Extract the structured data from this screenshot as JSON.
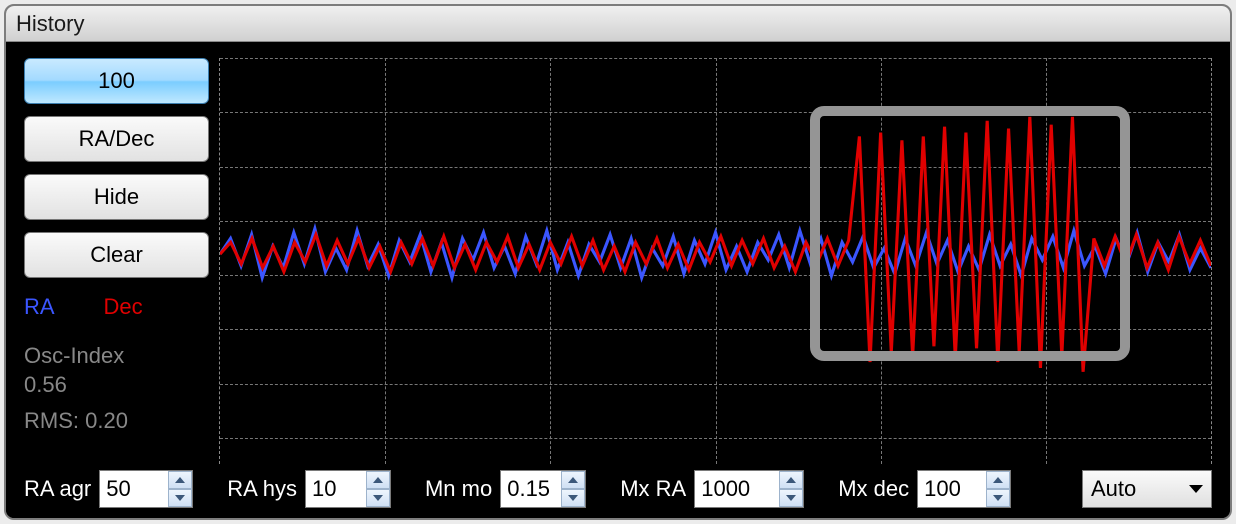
{
  "window": {
    "title": "History"
  },
  "buttons": {
    "scale": "100",
    "mode": "RA/Dec",
    "hide": "Hide",
    "clear": "Clear"
  },
  "legend": {
    "ra": "RA",
    "dec": "Dec"
  },
  "status": {
    "osc_label": "Osc-Index",
    "osc_value": "0.56",
    "rms_label": "RMS:",
    "rms_value": "0.20"
  },
  "params": {
    "ra_agr": {
      "label": "RA agr",
      "value": "50"
    },
    "ra_hys": {
      "label": "RA hys",
      "value": "10"
    },
    "mn_mo": {
      "label": "Mn mo",
      "value": "0.15"
    },
    "mx_ra": {
      "label": "Mx RA",
      "value": "1000"
    },
    "mx_dec": {
      "label": "Mx dec",
      "value": "100"
    }
  },
  "dropdown": {
    "selected": "Auto"
  },
  "colors": {
    "ra": "#3b56ff",
    "dec": "#e00000"
  },
  "chart_data": {
    "type": "line",
    "title": "",
    "xlabel": "",
    "ylabel": "",
    "ylim": [
      -100,
      100
    ],
    "x_range": [
      0,
      960
    ],
    "series": [
      {
        "name": "RA",
        "color": "#3b56ff",
        "values": [
          0,
          8,
          -6,
          10,
          -12,
          4,
          -7,
          11,
          -5,
          13,
          -9,
          3,
          -8,
          12,
          -6,
          5,
          -11,
          7,
          -4,
          10,
          -9,
          6,
          -12,
          8,
          -3,
          11,
          -7,
          4,
          -10,
          9,
          -5,
          12,
          -8,
          6,
          -11,
          5,
          -4,
          10,
          -7,
          8,
          -12,
          3,
          -6,
          9,
          -10,
          7,
          -5,
          11,
          -8,
          4,
          -9,
          6,
          -3,
          10,
          -7,
          12,
          -5,
          8,
          -11,
          6,
          -4,
          9,
          -7,
          3,
          -10,
          8,
          -6,
          11,
          -5,
          7,
          -9,
          4,
          -8,
          10,
          -6,
          5,
          -11,
          8,
          -3,
          9,
          -7,
          12,
          -6,
          4,
          -10,
          8,
          -5,
          11,
          -9,
          6,
          -4,
          10,
          -8,
          3,
          -7
        ]
      },
      {
        "name": "Dec",
        "color": "#e00000",
        "values": [
          0,
          6,
          -5,
          8,
          -7,
          4,
          -9,
          6,
          -4,
          10,
          -6,
          7,
          -5,
          8,
          -7,
          4,
          -9,
          6,
          -5,
          8,
          -6,
          9,
          -7,
          5,
          -8,
          6,
          -4,
          9,
          -7,
          5,
          -8,
          6,
          -5,
          9,
          -6,
          7,
          -8,
          4,
          -9,
          6,
          -5,
          8,
          -7,
          5,
          -8,
          6,
          -4,
          9,
          -6,
          7,
          -5,
          8,
          -7,
          4,
          -9,
          6,
          -5,
          8,
          -6,
          7,
          60,
          -55,
          62,
          -50,
          58,
          -52,
          60,
          -47,
          65,
          -53,
          62,
          -48,
          68,
          -55,
          64,
          -50,
          70,
          -58,
          66,
          -52,
          70,
          -60,
          8,
          -6,
          9,
          -5,
          10,
          -7,
          6,
          -8,
          9,
          -5,
          7,
          -6
        ]
      }
    ]
  }
}
